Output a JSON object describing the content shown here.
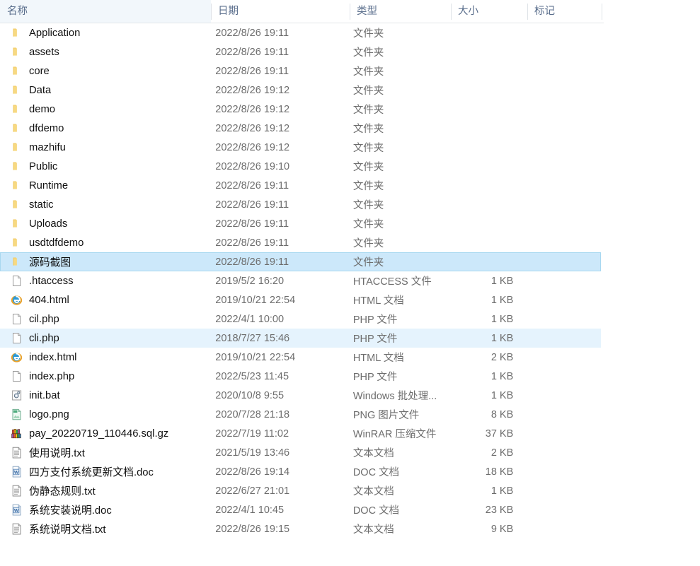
{
  "window": {
    "type": "file-explorer-list-view",
    "language": "zh-CN"
  },
  "colors": {
    "selected_row_bg": "#cce8fa",
    "selected_row_border": "#a8d8f0",
    "hover_row_bg": "#e5f3fd",
    "header_text": "#5a6e8c",
    "row_text": "#101010",
    "meta_text": "#6d6d6d",
    "folder_icon": "#f5d680",
    "background": "#ffffff"
  },
  "columns": [
    {
      "key": "name",
      "label": "名称",
      "sort": "ascending",
      "sort_icon": "chevron-up-icon"
    },
    {
      "key": "date",
      "label": "日期",
      "sort": "none"
    },
    {
      "key": "type",
      "label": "类型",
      "sort": "none"
    },
    {
      "key": "size",
      "label": "大小",
      "sort": "none"
    },
    {
      "key": "tags",
      "label": "标记",
      "sort": "none"
    }
  ],
  "rows": [
    {
      "name": "Application",
      "date": "2022/8/26 19:11",
      "type": "文件夹",
      "size": "",
      "tags": "",
      "icon": "folder-icon",
      "state": "normal"
    },
    {
      "name": "assets",
      "date": "2022/8/26 19:11",
      "type": "文件夹",
      "size": "",
      "tags": "",
      "icon": "folder-icon",
      "state": "normal"
    },
    {
      "name": "core",
      "date": "2022/8/26 19:11",
      "type": "文件夹",
      "size": "",
      "tags": "",
      "icon": "folder-icon",
      "state": "normal"
    },
    {
      "name": "Data",
      "date": "2022/8/26 19:12",
      "type": "文件夹",
      "size": "",
      "tags": "",
      "icon": "folder-icon",
      "state": "normal"
    },
    {
      "name": "demo",
      "date": "2022/8/26 19:12",
      "type": "文件夹",
      "size": "",
      "tags": "",
      "icon": "folder-icon",
      "state": "normal"
    },
    {
      "name": "dfdemo",
      "date": "2022/8/26 19:12",
      "type": "文件夹",
      "size": "",
      "tags": "",
      "icon": "folder-icon",
      "state": "normal"
    },
    {
      "name": "mazhifu",
      "date": "2022/8/26 19:12",
      "type": "文件夹",
      "size": "",
      "tags": "",
      "icon": "folder-icon",
      "state": "normal"
    },
    {
      "name": "Public",
      "date": "2022/8/26 19:10",
      "type": "文件夹",
      "size": "",
      "tags": "",
      "icon": "folder-icon",
      "state": "normal"
    },
    {
      "name": "Runtime",
      "date": "2022/8/26 19:11",
      "type": "文件夹",
      "size": "",
      "tags": "",
      "icon": "folder-icon",
      "state": "normal"
    },
    {
      "name": "static",
      "date": "2022/8/26 19:11",
      "type": "文件夹",
      "size": "",
      "tags": "",
      "icon": "folder-icon",
      "state": "normal"
    },
    {
      "name": "Uploads",
      "date": "2022/8/26 19:11",
      "type": "文件夹",
      "size": "",
      "tags": "",
      "icon": "folder-icon",
      "state": "normal"
    },
    {
      "name": "usdtdfdemo",
      "date": "2022/8/26 19:11",
      "type": "文件夹",
      "size": "",
      "tags": "",
      "icon": "folder-icon",
      "state": "normal"
    },
    {
      "name": "源码截图",
      "date": "2022/8/26 19:11",
      "type": "文件夹",
      "size": "",
      "tags": "",
      "icon": "folder-icon",
      "state": "selected"
    },
    {
      "name": ".htaccess",
      "date": "2019/5/2 16:20",
      "type": "HTACCESS 文件",
      "size": "1 KB",
      "tags": "",
      "icon": "blank-document-icon",
      "state": "normal"
    },
    {
      "name": "404.html",
      "date": "2019/10/21 22:54",
      "type": "HTML 文档",
      "size": "1 KB",
      "tags": "",
      "icon": "internet-explorer-icon",
      "state": "normal"
    },
    {
      "name": "cil.php",
      "date": "2022/4/1 10:00",
      "type": "PHP 文件",
      "size": "1 KB",
      "tags": "",
      "icon": "blank-document-icon",
      "state": "normal"
    },
    {
      "name": "cli.php",
      "date": "2018/7/27 15:46",
      "type": "PHP 文件",
      "size": "1 KB",
      "tags": "",
      "icon": "blank-document-icon",
      "state": "hover"
    },
    {
      "name": "index.html",
      "date": "2019/10/21 22:54",
      "type": "HTML 文档",
      "size": "2 KB",
      "tags": "",
      "icon": "internet-explorer-icon",
      "state": "normal"
    },
    {
      "name": "index.php",
      "date": "2022/5/23 11:45",
      "type": "PHP 文件",
      "size": "1 KB",
      "tags": "",
      "icon": "blank-document-icon",
      "state": "normal"
    },
    {
      "name": "init.bat",
      "date": "2020/10/8 9:55",
      "type": "Windows 批处理...",
      "size": "1 KB",
      "tags": "",
      "icon": "gear-batch-icon",
      "state": "normal"
    },
    {
      "name": "logo.png",
      "date": "2020/7/28 21:18",
      "type": "PNG 图片文件",
      "size": "8 KB",
      "tags": "",
      "icon": "image-file-icon",
      "state": "normal"
    },
    {
      "name": "pay_20220719_110446.sql.gz",
      "date": "2022/7/19 11:02",
      "type": "WinRAR 压缩文件",
      "size": "37 KB",
      "tags": "",
      "icon": "winrar-archive-icon",
      "state": "normal"
    },
    {
      "name": "使用说明.txt",
      "date": "2021/5/19 13:46",
      "type": "文本文档",
      "size": "2 KB",
      "tags": "",
      "icon": "text-document-icon",
      "state": "normal"
    },
    {
      "name": "四方支付系统更新文档.doc",
      "date": "2022/8/26 19:14",
      "type": "DOC 文档",
      "size": "18 KB",
      "tags": "",
      "icon": "word-document-icon",
      "state": "normal"
    },
    {
      "name": "伪静态规则.txt",
      "date": "2022/6/27 21:01",
      "type": "文本文档",
      "size": "1 KB",
      "tags": "",
      "icon": "text-document-icon",
      "state": "normal"
    },
    {
      "name": "系统安装说明.doc",
      "date": "2022/4/1 10:45",
      "type": "DOC 文档",
      "size": "23 KB",
      "tags": "",
      "icon": "word-document-icon",
      "state": "normal"
    },
    {
      "name": "系统说明文档.txt",
      "date": "2022/8/26 19:15",
      "type": "文本文档",
      "size": "9 KB",
      "tags": "",
      "icon": "text-document-icon",
      "state": "normal"
    }
  ]
}
